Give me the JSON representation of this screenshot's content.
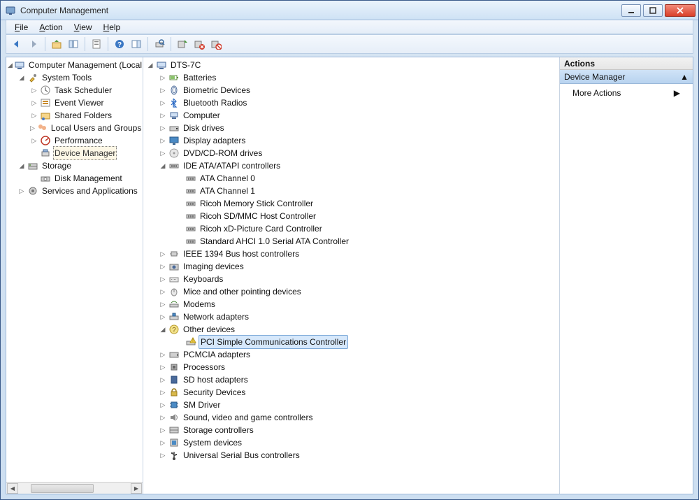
{
  "window": {
    "title": "Computer Management"
  },
  "menu": {
    "file": "File",
    "action": "Action",
    "view": "View",
    "help": "Help"
  },
  "leftTree": {
    "root": "Computer Management (Local",
    "systools": "System Tools",
    "taskSched": "Task Scheduler",
    "eventViewer": "Event Viewer",
    "sharedFolders": "Shared Folders",
    "localUsers": "Local Users and Groups",
    "performance": "Performance",
    "deviceManager": "Device Manager",
    "storage": "Storage",
    "diskMgmt": "Disk Management",
    "services": "Services and Applications"
  },
  "deviceTree": {
    "root": "DTS-7C",
    "batteries": "Batteries",
    "biometric": "Biometric Devices",
    "bluetooth": "Bluetooth Radios",
    "computer": "Computer",
    "diskdrives": "Disk drives",
    "displayAdapters": "Display adapters",
    "dvd": "DVD/CD-ROM drives",
    "ide": "IDE ATA/ATAPI controllers",
    "ata0": "ATA Channel 0",
    "ata1": "ATA Channel 1",
    "ricohMs": "Ricoh Memory Stick Controller",
    "ricohSd": "Ricoh SD/MMC Host Controller",
    "ricohXd": "Ricoh xD-Picture Card Controller",
    "ahci": "Standard AHCI 1.0 Serial ATA Controller",
    "ieee1394": "IEEE 1394 Bus host controllers",
    "imaging": "Imaging devices",
    "keyboards": "Keyboards",
    "mice": "Mice and other pointing devices",
    "modems": "Modems",
    "network": "Network adapters",
    "otherDevices": "Other devices",
    "pciSimple": "PCI Simple Communications Controller",
    "pcmcia": "PCMCIA adapters",
    "processors": "Processors",
    "sdhost": "SD host adapters",
    "security": "Security Devices",
    "smdriver": "SM Driver",
    "sound": "Sound, video and game controllers",
    "storageCtl": "Storage controllers",
    "sysdev": "System devices",
    "usb": "Universal Serial Bus controllers"
  },
  "actions": {
    "header": "Actions",
    "section": "Device Manager",
    "more": "More Actions"
  }
}
